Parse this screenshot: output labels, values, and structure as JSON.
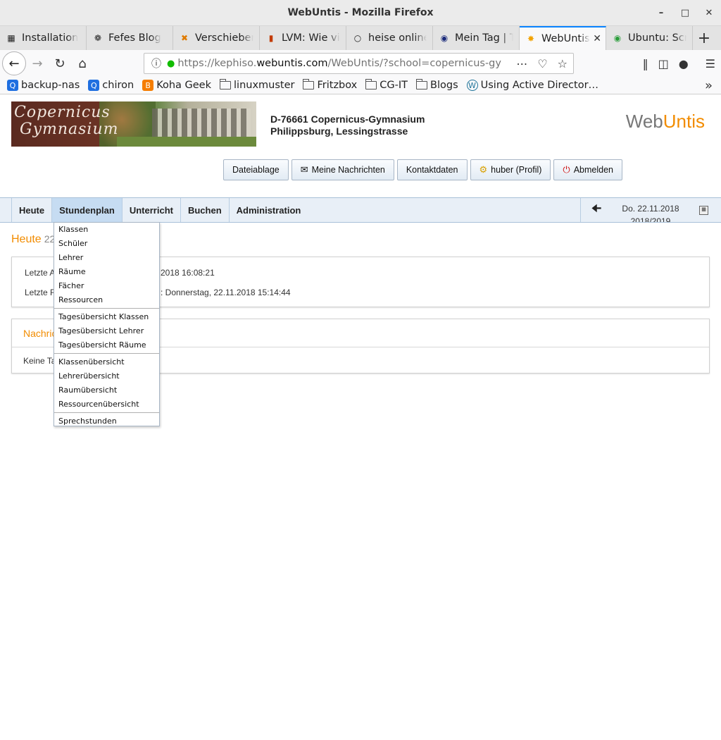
{
  "window": {
    "title": "WebUntis - Mozilla Firefox"
  },
  "tabs": [
    {
      "label": "Installation",
      "icon": "book-icon"
    },
    {
      "label": "Fefes Blog",
      "icon": "fefe-icon"
    },
    {
      "label": "Verschieben",
      "icon": "x-icon"
    },
    {
      "label": "LVM: Wie vi",
      "icon": "bookmark-icon"
    },
    {
      "label": "heise online",
      "icon": "heise-icon"
    },
    {
      "label": "Mein Tag | Ta",
      "icon": "w-icon"
    },
    {
      "label": "WebUntis",
      "icon": "webuntis-icon",
      "active": true
    },
    {
      "label": "Ubuntu: Scre",
      "icon": "g-icon"
    }
  ],
  "url": {
    "prefix": "https://kephiso.",
    "domain": "webuntis.com",
    "rest": "/WebUntis/?school=copernicus-gym"
  },
  "bookmarks": [
    {
      "label": "backup-nas",
      "type": "site"
    },
    {
      "label": "chiron",
      "type": "site"
    },
    {
      "label": "Koha Geek",
      "type": "blogger"
    },
    {
      "label": "linuxmuster",
      "type": "folder"
    },
    {
      "label": "Fritzbox",
      "type": "folder"
    },
    {
      "label": "CG-IT",
      "type": "folder"
    },
    {
      "label": "Blogs",
      "type": "folder"
    },
    {
      "label": "Using Active Director…",
      "type": "wordpress"
    }
  ],
  "header": {
    "school_line1": "D-76661 Copernicus-Gymnasium",
    "school_line2": "Philippsburg, Lessingstrasse",
    "brand_web": "Web",
    "brand_untis": "Untis"
  },
  "topbuttons": {
    "dateiablage": "Dateiablage",
    "nachrichten": "Meine Nachrichten",
    "kontakt": "Kontaktdaten",
    "profil": "huber (Profil)",
    "abmelden": "Abmelden"
  },
  "menu": {
    "heute": "Heute",
    "stundenplan": "Stundenplan",
    "unterricht": "Unterricht",
    "buchen": "Buchen",
    "administration": "Administration",
    "date": "Do. 22.11.2018",
    "schoolyear": "2018/2019"
  },
  "content": {
    "heute_title": "Heute",
    "heute_date": "22",
    "login_label": "Letzte A",
    "login_value": "2018 16:08:21",
    "r_label": "Letzte R",
    "r_value": ": Donnerstag, 22.11.2018 15:14:44",
    "nachr_title": "Nachric",
    "nachr_body": "Keine Ta"
  },
  "dropdown": {
    "group1": [
      "Klassen",
      "Schüler",
      "Lehrer",
      "Räume",
      "Fächer",
      "Ressourcen"
    ],
    "group2": [
      "Tagesübersicht Klassen",
      "Tagesübersicht Lehrer",
      "Tagesübersicht Räume"
    ],
    "group3": [
      "Klassenübersicht",
      "Lehrerübersicht",
      "Raumübersicht",
      "Ressourcenübersicht"
    ],
    "group4": [
      "Sprechstunden"
    ]
  },
  "colors": {
    "accent": "#f28c00",
    "menu_bg": "#e8eff7",
    "menu_active": "#c6dcf2"
  }
}
